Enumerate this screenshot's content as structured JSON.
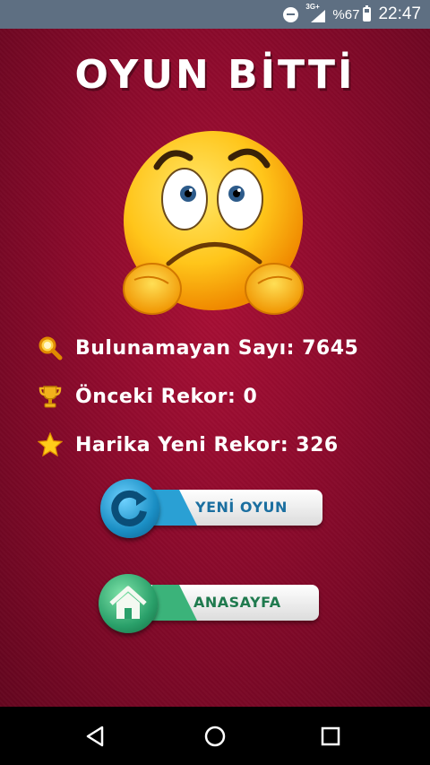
{
  "status_bar": {
    "network": "3G+",
    "battery_percent": "%67",
    "battery_level": 0.67,
    "time": "22:47"
  },
  "screen": {
    "title": "OYUN BİTTİ",
    "emoji": "sad-worried-face",
    "stats": [
      {
        "icon": "magnifier-icon",
        "text": "Bulunamayan Sayı: 7645"
      },
      {
        "icon": "trophy-icon",
        "text": "Önceki Rekor: 0"
      },
      {
        "icon": "star-icon",
        "text": "Harika Yeni Rekor: 326"
      }
    ],
    "buttons": {
      "new_game": "YENİ OYUN",
      "home": "ANASAYFA"
    }
  },
  "colors": {
    "background": "#8c0a2c",
    "new_game_accent": "#1a8ec4",
    "new_game_text": "#1b6fa0",
    "home_accent": "#2aa06a",
    "home_text": "#1f7a4e"
  }
}
